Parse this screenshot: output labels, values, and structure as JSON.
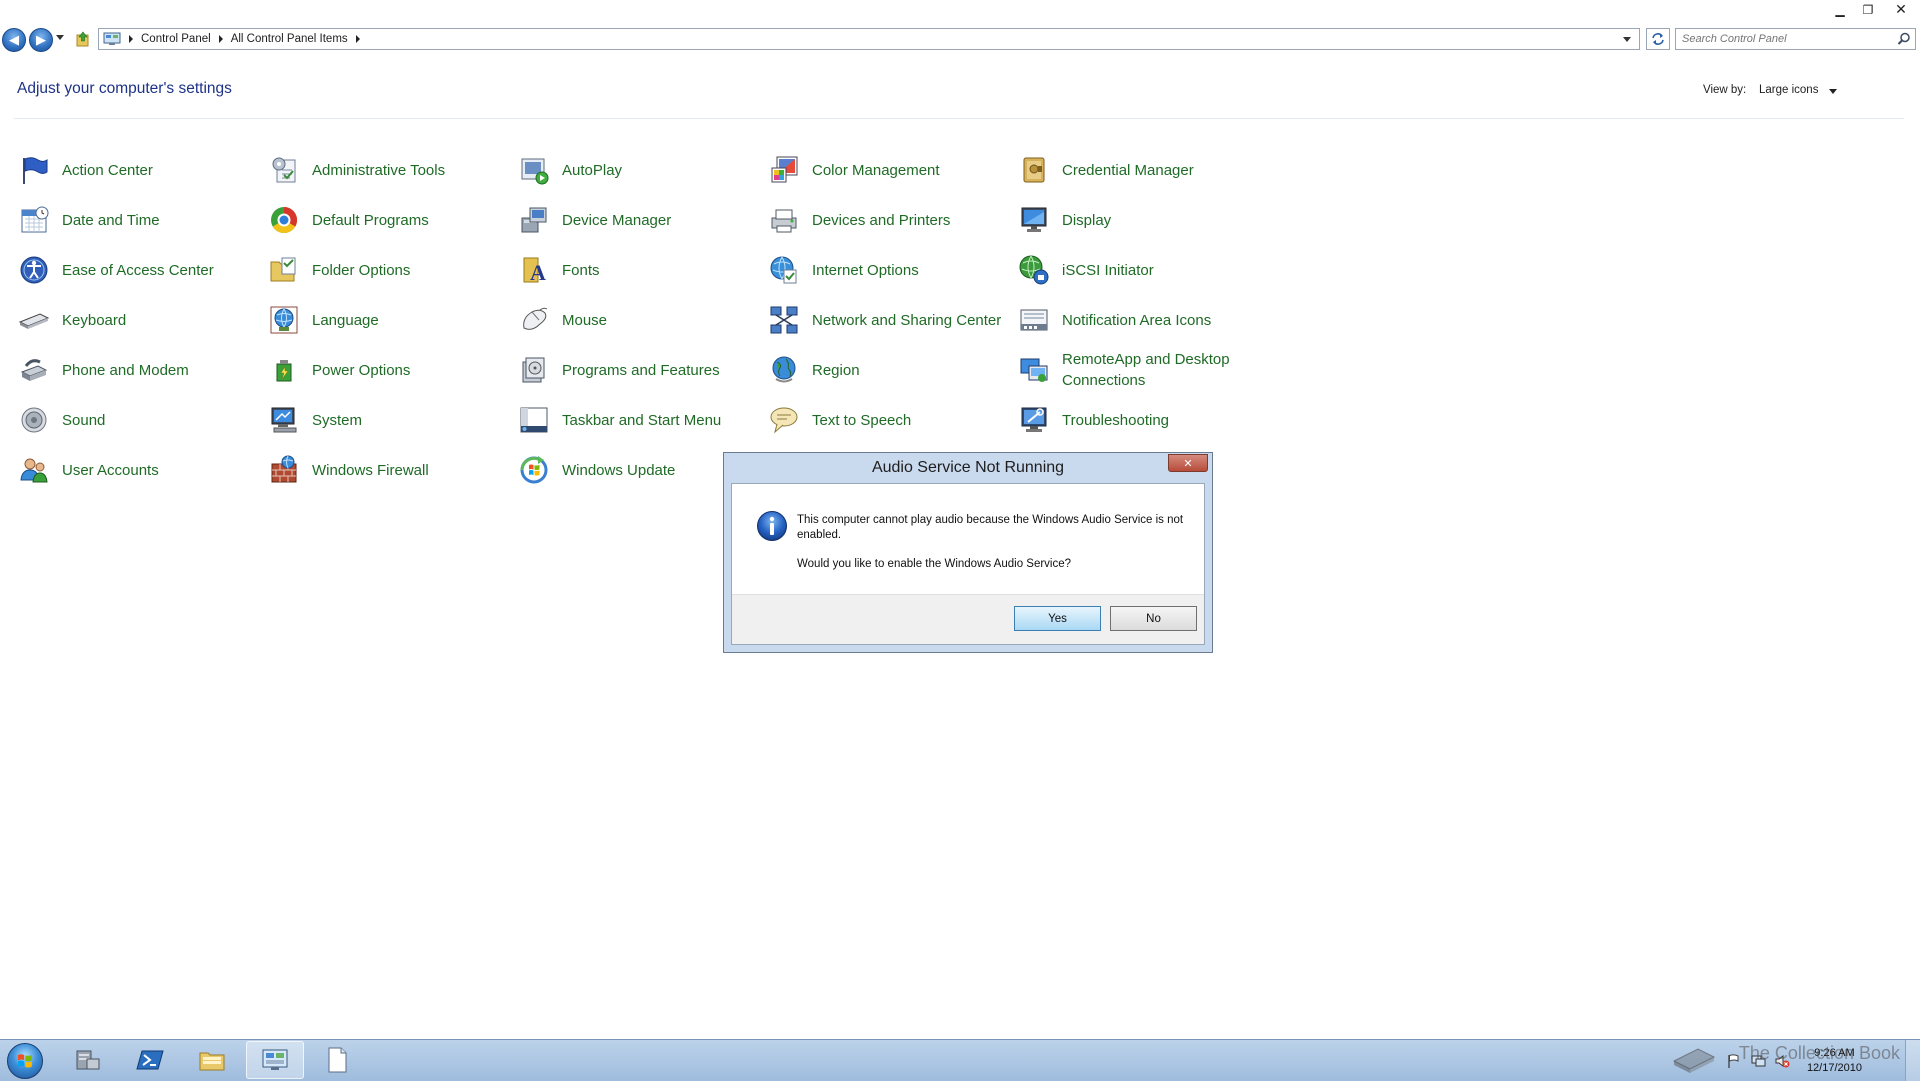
{
  "window": {
    "minimize_glyph": "▁",
    "restore_glyph": "❐",
    "close_glyph": "✕"
  },
  "address_bar": {
    "breadcrumbs": [
      "Control Panel",
      "All Control Panel Items"
    ],
    "search_placeholder": "Search Control Panel"
  },
  "header": {
    "title": "Adjust your computer's settings",
    "view_by_label": "View by:",
    "view_by_value": "Large icons"
  },
  "items": [
    {
      "label": "Action Center",
      "icon": "flag-icon"
    },
    {
      "label": "Administrative Tools",
      "icon": "admin-tools-icon"
    },
    {
      "label": "AutoPlay",
      "icon": "autoplay-icon"
    },
    {
      "label": "Color Management",
      "icon": "color-management-icon"
    },
    {
      "label": "Credential Manager",
      "icon": "credential-vault-icon"
    },
    {
      "label": "Date and Time",
      "icon": "calendar-clock-icon"
    },
    {
      "label": "Default Programs",
      "icon": "default-programs-icon"
    },
    {
      "label": "Device Manager",
      "icon": "device-manager-icon"
    },
    {
      "label": "Devices and Printers",
      "icon": "printer-icon"
    },
    {
      "label": "Display",
      "icon": "monitor-icon"
    },
    {
      "label": "Ease of Access Center",
      "icon": "ease-of-access-icon"
    },
    {
      "label": "Folder Options",
      "icon": "folder-options-icon"
    },
    {
      "label": "Fonts",
      "icon": "fonts-icon"
    },
    {
      "label": "Internet Options",
      "icon": "internet-options-icon"
    },
    {
      "label": "iSCSI Initiator",
      "icon": "iscsi-globe-icon"
    },
    {
      "label": "Keyboard",
      "icon": "keyboard-icon"
    },
    {
      "label": "Language",
      "icon": "language-globe-icon"
    },
    {
      "label": "Mouse",
      "icon": "mouse-icon"
    },
    {
      "label": "Network and Sharing Center",
      "icon": "network-icon"
    },
    {
      "label": "Notification Area Icons",
      "icon": "notification-area-icon"
    },
    {
      "label": "Phone and Modem",
      "icon": "phone-modem-icon"
    },
    {
      "label": "Power Options",
      "icon": "power-options-icon"
    },
    {
      "label": "Programs and Features",
      "icon": "programs-features-icon"
    },
    {
      "label": "Region",
      "icon": "region-globe-icon"
    },
    {
      "label": "RemoteApp and Desktop Connections",
      "icon": "remoteapp-icon"
    },
    {
      "label": "Sound",
      "icon": "speaker-icon"
    },
    {
      "label": "System",
      "icon": "system-icon"
    },
    {
      "label": "Taskbar and Start Menu",
      "icon": "taskbar-icon"
    },
    {
      "label": "Text to Speech",
      "icon": "speech-bubble-icon"
    },
    {
      "label": "Troubleshooting",
      "icon": "troubleshooting-icon"
    },
    {
      "label": "User Accounts",
      "icon": "users-icon"
    },
    {
      "label": "Windows Firewall",
      "icon": "firewall-icon"
    },
    {
      "label": "Windows Update",
      "icon": "windows-update-icon"
    }
  ],
  "dialog": {
    "title": "Audio Service Not Running",
    "close_glyph": "✕",
    "message_line1": "This computer cannot play audio because the Windows Audio Service is not enabled.",
    "message_line2": "Would you like to enable the Windows Audio Service?",
    "yes_label": "Yes",
    "no_label": "No"
  },
  "taskbar": {
    "apps": [
      "server-manager-icon",
      "powershell-icon",
      "explorer-folder-icon",
      "control-panel-icon",
      "blank-document-icon"
    ],
    "active_app": "control-panel-icon",
    "time": "9:26 AM",
    "date": "12/17/2010",
    "watermark": "The Collection Book"
  },
  "colors": {
    "link_green": "#1f6b26",
    "title_blue": "#1e3287",
    "dialog_frame": "#c9d9ee",
    "taskbar": "#9fbcdd"
  }
}
